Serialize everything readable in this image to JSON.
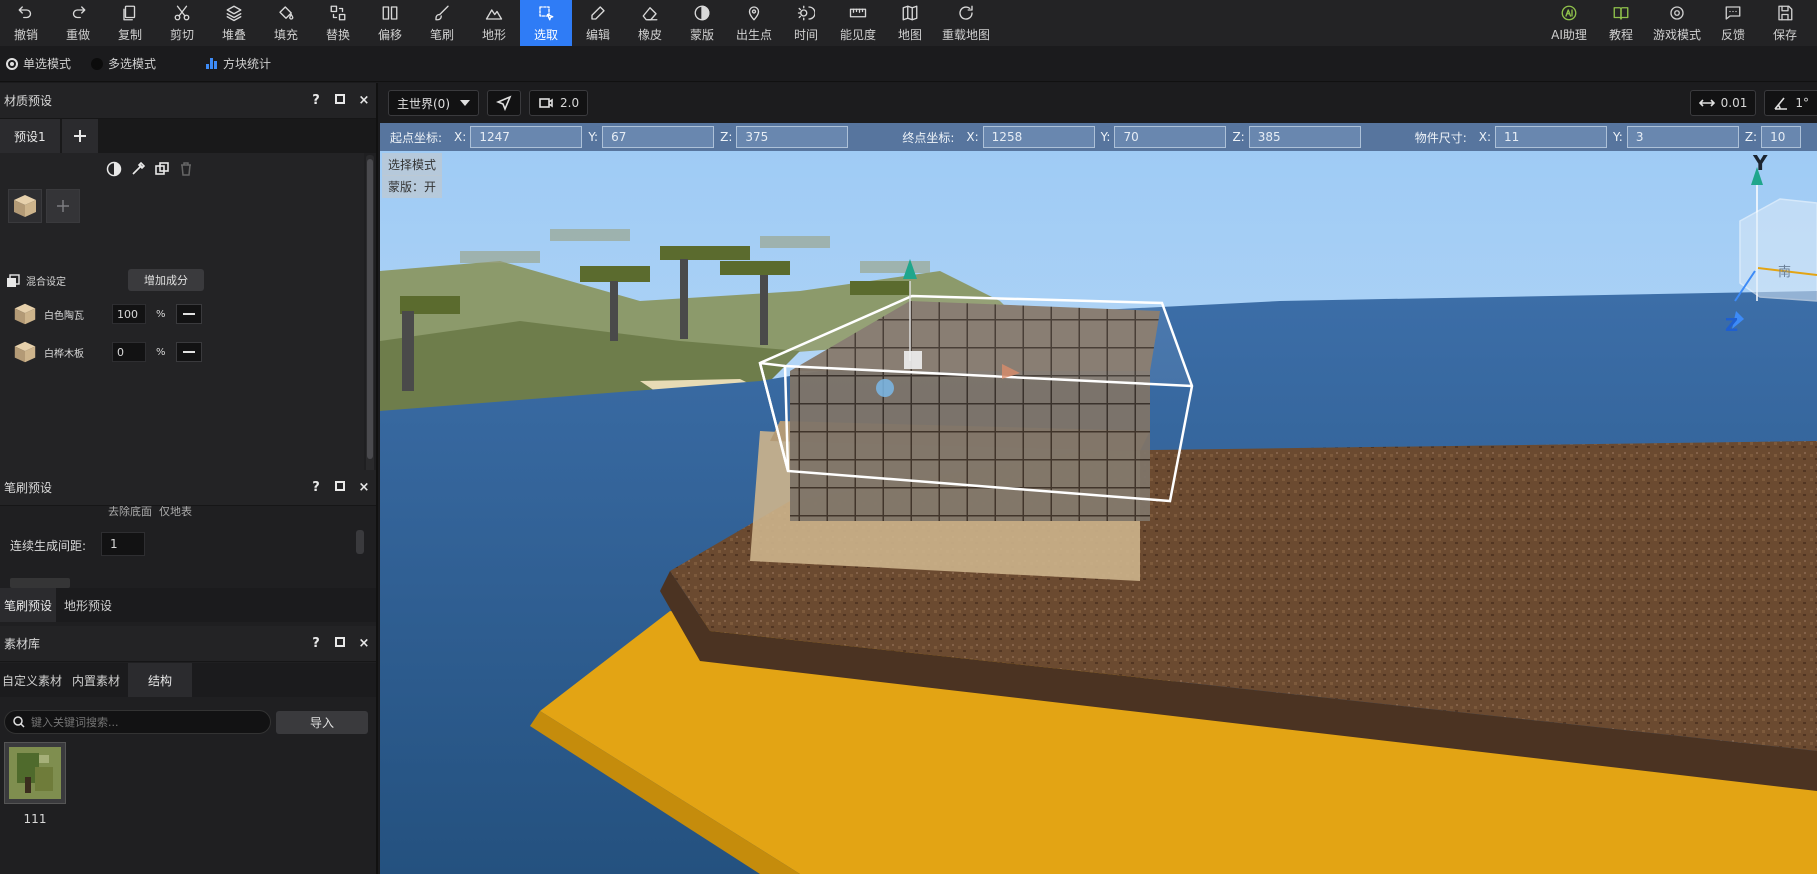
{
  "toolbar": {
    "tools": [
      {
        "name": "undo",
        "icon": "undo-icon",
        "label": "撤销"
      },
      {
        "name": "redo",
        "icon": "redo-icon",
        "label": "重做"
      },
      {
        "name": "copy",
        "icon": "copy-icon",
        "label": "复制"
      },
      {
        "name": "cut",
        "icon": "scissors-icon",
        "label": "剪切"
      },
      {
        "name": "stack",
        "icon": "layers-icon",
        "label": "堆叠"
      },
      {
        "name": "fill",
        "icon": "paint-bucket-icon",
        "label": "填充"
      },
      {
        "name": "replace",
        "icon": "replace-icon",
        "label": "替换"
      },
      {
        "name": "offset",
        "icon": "offset-icon",
        "label": "偏移"
      },
      {
        "name": "brush",
        "icon": "brush-icon",
        "label": "笔刷"
      },
      {
        "name": "terrain",
        "icon": "mountain-icon",
        "label": "地形"
      },
      {
        "name": "select",
        "icon": "select-icon",
        "label": "选取",
        "active": true
      },
      {
        "name": "edit",
        "icon": "pencil-icon",
        "label": "编辑"
      },
      {
        "name": "eraser",
        "icon": "eraser-icon",
        "label": "橡皮"
      },
      {
        "name": "mask",
        "icon": "half-circle-icon",
        "label": "蒙版"
      },
      {
        "name": "spawn",
        "icon": "map-pin-icon",
        "label": "出生点"
      },
      {
        "name": "time",
        "icon": "sun-moon-icon",
        "label": "时间"
      },
      {
        "name": "visibility",
        "icon": "ruler-icon",
        "label": "能见度"
      },
      {
        "name": "map",
        "icon": "map-icon",
        "label": "地图"
      },
      {
        "name": "reload-map",
        "icon": "reload-icon",
        "label": "重载地图"
      }
    ],
    "right_tools": [
      {
        "name": "ai-assistant",
        "icon": "ai-icon",
        "label": "AI助理"
      },
      {
        "name": "tutorial",
        "icon": "book-icon",
        "label": "教程"
      },
      {
        "name": "game-mode",
        "icon": "gamepad-icon",
        "label": "游戏模式"
      },
      {
        "name": "feedback",
        "icon": "chat-icon",
        "label": "反馈"
      },
      {
        "name": "save",
        "icon": "save-icon",
        "label": "保存"
      }
    ]
  },
  "modebar": {
    "single_select": "单选模式",
    "multi_select": "多选模式",
    "block_stats": "方块统计"
  },
  "material_panel": {
    "title": "材质预设",
    "help": "?",
    "preset_tab": "预设1",
    "mix_label": "混合设定",
    "add_component": "增加成分",
    "components": [
      {
        "name": "白色陶瓦",
        "value": "100",
        "unit": "%"
      },
      {
        "name": "白桦木板",
        "value": "0",
        "unit": "%"
      }
    ]
  },
  "brush_panel": {
    "title": "笔刷预设",
    "help": "?",
    "clipped_row": "去除底面  仅地表",
    "interval_label": "连续生成间距:",
    "interval_value": "1",
    "tabs": [
      "笔刷预设",
      "地形预设"
    ]
  },
  "asset_panel": {
    "title": "素材库",
    "help": "?",
    "tabs": [
      "自定义素材",
      "内置素材",
      "结构"
    ],
    "search_placeholder": "键入关键词搜索...",
    "import_label": "导入",
    "items": [
      {
        "label": "111"
      }
    ]
  },
  "viewport": {
    "world_select": "主世界(0)",
    "speed": "2.0",
    "step": "0.01",
    "angle": "1°",
    "start_label": "起点坐标:",
    "start": {
      "x": "1247",
      "y": "67",
      "z": "375"
    },
    "end_label": "终点坐标:",
    "end": {
      "x": "1258",
      "y": "70",
      "z": "385"
    },
    "size_label": "物件尺寸:",
    "size": {
      "x": "11",
      "y": "3",
      "z": "10"
    },
    "axis_x": "X:",
    "axis_y": "Y:",
    "axis_z": "Z:",
    "mode_tag": "选择模式",
    "mask_tag": "蒙版：开",
    "gizmo_y": "Y",
    "gizmo_z": "Z",
    "cube_face": "南"
  },
  "colors": {
    "accent": "#2f7cf6",
    "ai_green": "#8fc14b",
    "selection": "#ffffff",
    "platform": "#e3a414",
    "dirt": "#6b4a30",
    "water": "#2f5f9a",
    "sky": "#a7cff6"
  }
}
